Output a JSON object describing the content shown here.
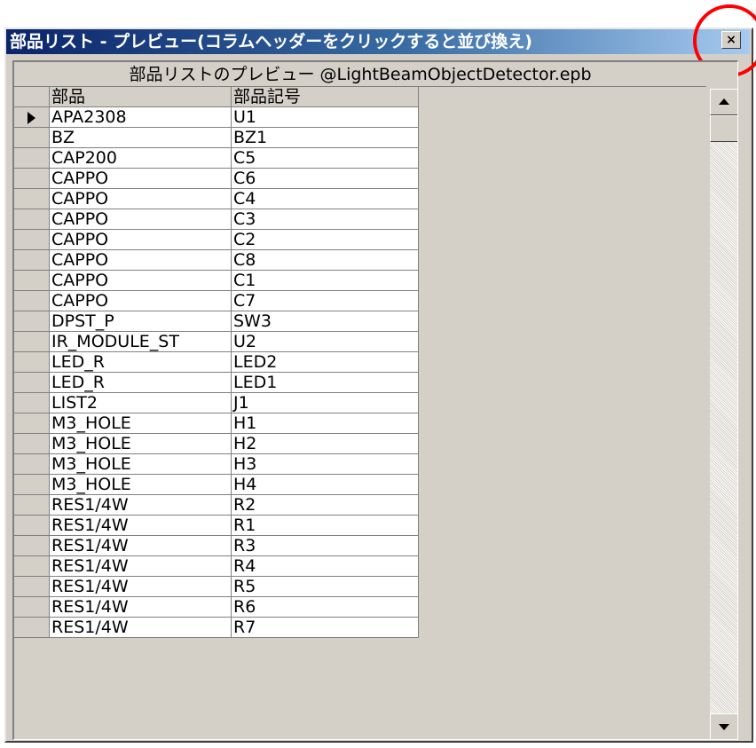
{
  "window": {
    "title": "部品リスト - プレビュー(コラムヘッダーをクリックすると並び換え)",
    "close_label": "×"
  },
  "grid": {
    "caption": "部品リストのプレビュー @LightBeamObjectDetector.epb",
    "columns": [
      "部品",
      "部品記号"
    ],
    "rows": [
      [
        "APA2308",
        "U1"
      ],
      [
        "BZ",
        "BZ1"
      ],
      [
        "CAP200",
        "C5"
      ],
      [
        "CAPPO",
        "C6"
      ],
      [
        "CAPPO",
        "C4"
      ],
      [
        "CAPPO",
        "C3"
      ],
      [
        "CAPPO",
        "C2"
      ],
      [
        "CAPPO",
        "C8"
      ],
      [
        "CAPPO",
        "C1"
      ],
      [
        "CAPPO",
        "C7"
      ],
      [
        "DPST_P",
        "SW3"
      ],
      [
        "IR_MODULE_ST",
        "U2"
      ],
      [
        "LED_R",
        "LED2"
      ],
      [
        "LED_R",
        "LED1"
      ],
      [
        "LIST2",
        "J1"
      ],
      [
        "M3_HOLE",
        "H1"
      ],
      [
        "M3_HOLE",
        "H2"
      ],
      [
        "M3_HOLE",
        "H3"
      ],
      [
        "M3_HOLE",
        "H4"
      ],
      [
        "RES1/4W",
        "R2"
      ],
      [
        "RES1/4W",
        "R1"
      ],
      [
        "RES1/4W",
        "R3"
      ],
      [
        "RES1/4W",
        "R4"
      ],
      [
        "RES1/4W",
        "R5"
      ],
      [
        "RES1/4W",
        "R6"
      ],
      [
        "RES1/4W",
        "R7"
      ]
    ],
    "current_row": 0
  },
  "icons": {
    "close": "close-icon",
    "row_pointer": "row-pointer-icon",
    "scroll_up": "arrow-up-icon",
    "scroll_down": "arrow-down-icon"
  },
  "colors": {
    "title_start": "#0a246a",
    "title_end": "#a6caf0",
    "highlight_circle": "#ff0000",
    "face": "#d4d0c8"
  }
}
